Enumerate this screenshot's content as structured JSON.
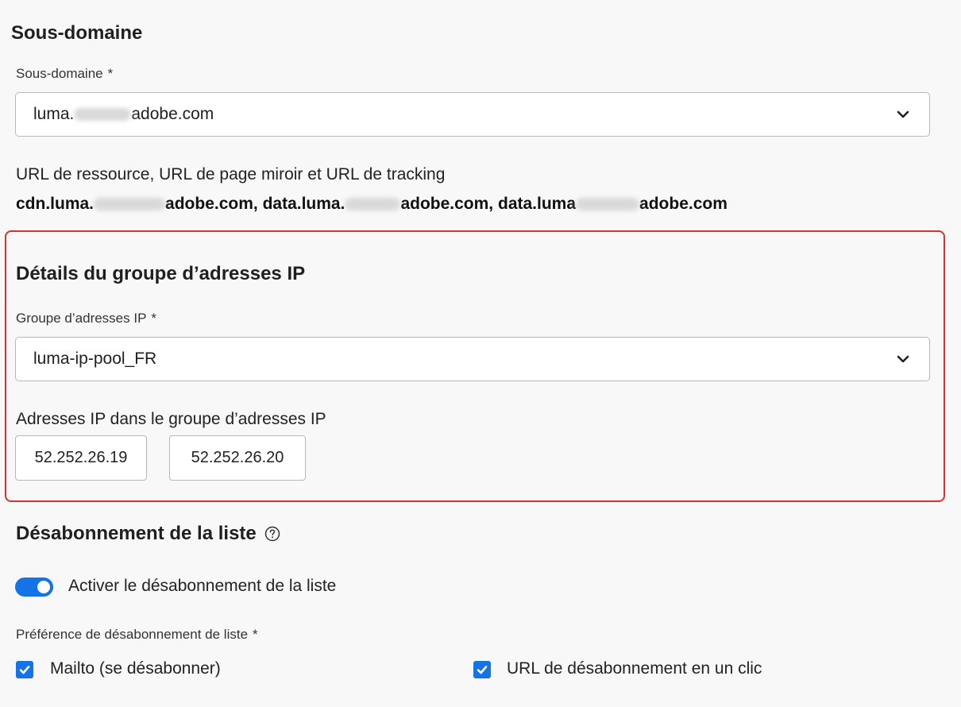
{
  "subdomain_section": {
    "title": "Sous-domaine",
    "field_label": "Sous-domaine",
    "required_mark": "*",
    "value_prefix": "luma.",
    "value_suffix": "adobe.com",
    "chevron_icon": "chevron-down-icon"
  },
  "resource_urls": {
    "label": "URL de ressource, URL de page miroir et URL de tracking",
    "url1_prefix": "cdn.luma.",
    "url1_suffix": "adobe.com,",
    "url2_prefix": "data.luma.",
    "url2_suffix": "adobe.com,",
    "url3_prefix": "data.luma",
    "url3_suffix": "adobe.com"
  },
  "ip_pool_section": {
    "title": "Détails du groupe d’adresses IP",
    "field_label": "Groupe d’adresses IP",
    "required_mark": "*",
    "value": "luma-ip-pool_FR",
    "ips_label": "Adresses IP dans le groupe d’adresses IP",
    "ips": [
      "52.252.26.19",
      "52.252.26.20"
    ],
    "highlight_color": "#d7322e"
  },
  "unsubscribe_section": {
    "title": "Désabonnement de la liste",
    "help_icon": "help-circle-icon",
    "toggle_label": "Activer le désabonnement de la liste",
    "toggle_on": true,
    "preference_label": "Préférence de désabonnement de liste",
    "required_mark": "*",
    "options": [
      {
        "label": "Mailto (se désabonner)",
        "checked": true
      },
      {
        "label": "URL de désabonnement en un clic",
        "checked": true
      }
    ],
    "accent_color": "#1473e6"
  }
}
